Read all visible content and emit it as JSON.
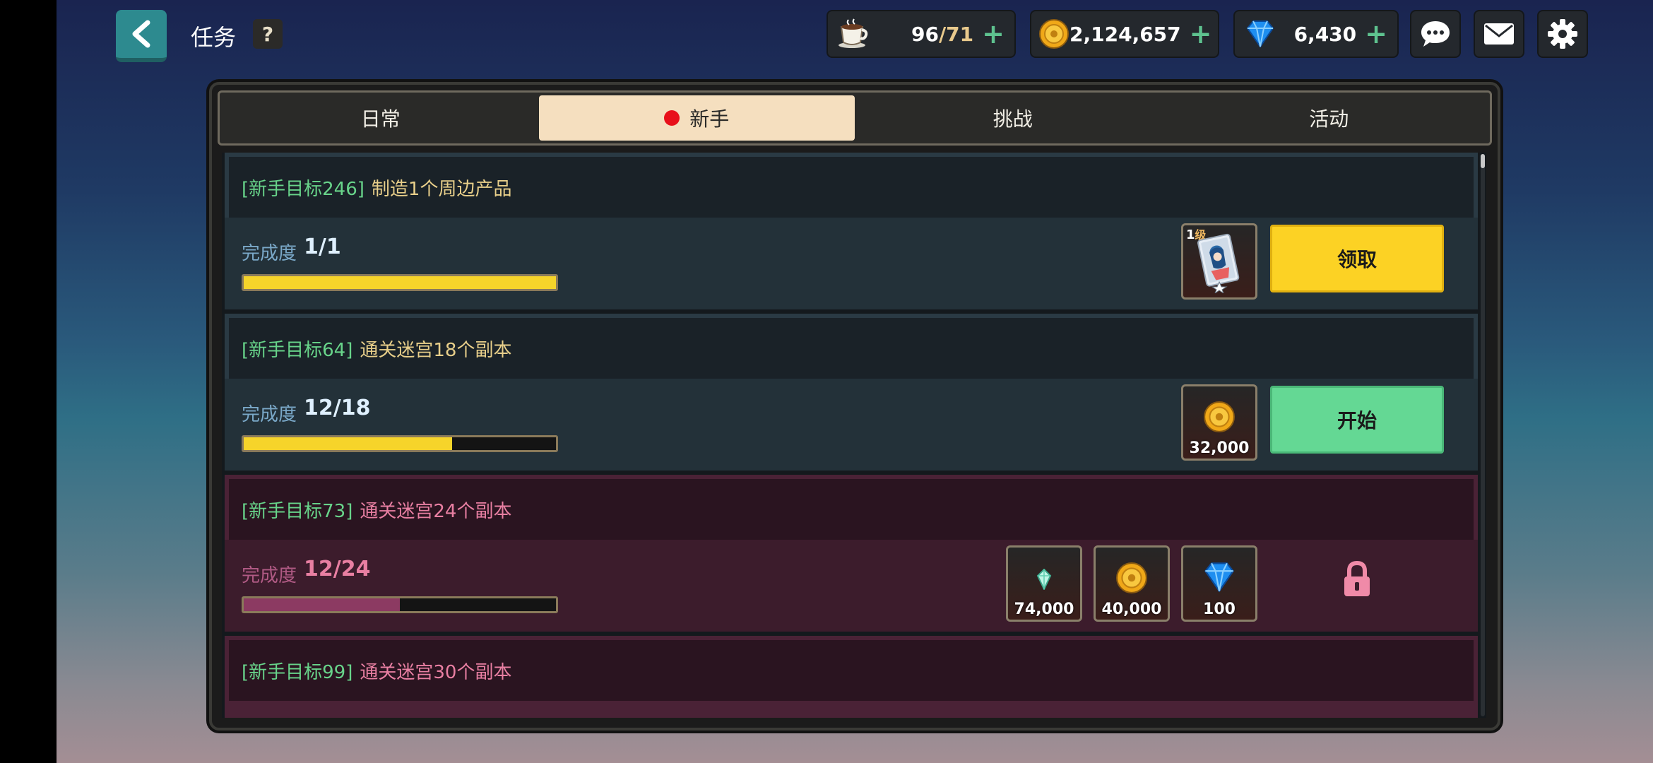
{
  "header": {
    "title": "任务",
    "help_label": "?",
    "back_icon": "chevron-left-icon"
  },
  "resources": {
    "stamina": {
      "current": "96",
      "cap": "/71",
      "plus": "+"
    },
    "gold": {
      "value": "2,124,657",
      "plus": "+"
    },
    "gems": {
      "value": "6,430",
      "plus": "+"
    }
  },
  "tabs": [
    {
      "label": "日常",
      "active": false
    },
    {
      "label": "新手",
      "active": true,
      "has_alert": true
    },
    {
      "label": "挑战",
      "active": false
    },
    {
      "label": "活动",
      "active": false
    }
  ],
  "quests": [
    {
      "tag": "[新手目标246]",
      "name": "制造1个周边产品",
      "progress_label": "完成度",
      "progress": "1/1",
      "progress_fraction": 1.0,
      "state": "claimable",
      "rewards": [
        {
          "type": "card",
          "level": "1",
          "level_unit": "级"
        }
      ],
      "action_label": "领取"
    },
    {
      "tag": "[新手目标64]",
      "name": "通关迷宫18个副本",
      "progress_label": "完成度",
      "progress": "12/18",
      "progress_fraction": 0.667,
      "state": "in-progress",
      "rewards": [
        {
          "type": "gold",
          "amount": "32,000"
        }
      ],
      "action_label": "开始"
    },
    {
      "tag": "[新手目标73]",
      "name": "通关迷宫24个副本",
      "progress_label": "完成度",
      "progress": "12/24",
      "progress_fraction": 0.5,
      "state": "locked",
      "rewards": [
        {
          "type": "crystal",
          "amount": "74,000"
        },
        {
          "type": "gold",
          "amount": "40,000"
        },
        {
          "type": "gem",
          "amount": "100"
        }
      ]
    },
    {
      "tag": "[新手目标99]",
      "name": "通关迷宫30个副本",
      "state": "locked"
    }
  ],
  "colors": {
    "tab_active_bg": "#f5dfbf",
    "claim_button": "#fcd224",
    "start_button": "#64d894",
    "progress_fill": "#f6d42a",
    "locked_fill": "#8c3a62",
    "alert_dot": "#e8101a"
  }
}
